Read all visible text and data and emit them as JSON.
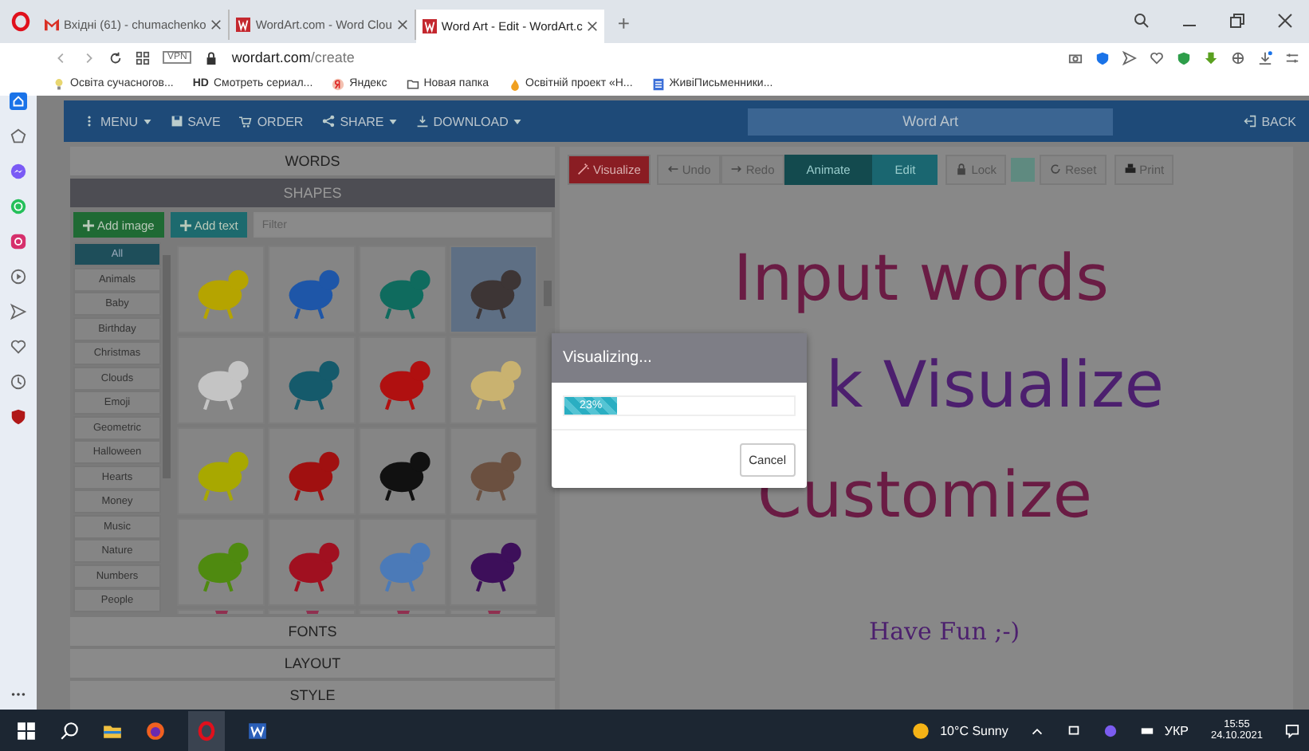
{
  "browser": {
    "tabs": [
      {
        "title": "Вхідні (61) - chumachenko",
        "selected": false,
        "kind": "mail"
      },
      {
        "title": "WordArt.com - Word Clou",
        "selected": false,
        "kind": "wordart"
      },
      {
        "title": "Word Art - Edit - WordArt.c",
        "selected": true,
        "kind": "wordart"
      }
    ],
    "new_tab": "+",
    "vpn": "VPN",
    "url_host": "wordart.com",
    "url_path": "/create",
    "bookmarks": [
      {
        "label": "Освіта сучасногов...",
        "kind": "bulb"
      },
      {
        "label": "Смотреть сериал...",
        "kind": "hd",
        "badge": "HD"
      },
      {
        "label": "Яндекс",
        "kind": "yandex"
      },
      {
        "label": "Новая папка",
        "kind": "folder"
      },
      {
        "label": "Освітній проект «Н...",
        "kind": "flame"
      },
      {
        "label": "ЖивіПисьменники...",
        "kind": "doc"
      }
    ]
  },
  "app": {
    "menu": [
      {
        "label": "MENU",
        "kind": "dots",
        "caret": true
      },
      {
        "label": "SAVE",
        "kind": "save",
        "caret": false
      },
      {
        "label": "ORDER",
        "kind": "cart",
        "caret": false
      },
      {
        "label": "SHARE",
        "kind": "share",
        "caret": true
      },
      {
        "label": "DOWNLOAD",
        "kind": "download",
        "caret": true
      }
    ],
    "title": "Word Art",
    "back": "BACK",
    "sections_top": [
      {
        "label": "WORDS",
        "selected": false
      },
      {
        "label": "SHAPES",
        "selected": true
      }
    ],
    "add_image": "Add image",
    "add_text": "Add text",
    "filter": {
      "placeholder": "Filter"
    },
    "categories": [
      {
        "label": "All",
        "selected": true
      },
      {
        "label": "Animals",
        "selected": false
      },
      {
        "label": "Baby",
        "selected": false
      },
      {
        "label": "Birthday",
        "selected": false
      },
      {
        "label": "Christmas",
        "selected": false
      },
      {
        "label": "Clouds",
        "selected": false
      },
      {
        "label": "Emoji",
        "selected": false
      },
      {
        "label": "Geometric",
        "selected": false
      },
      {
        "label": "Halloween",
        "selected": false
      },
      {
        "label": "Hearts",
        "selected": false
      },
      {
        "label": "Money",
        "selected": false
      },
      {
        "label": "Music",
        "selected": false
      },
      {
        "label": "Nature",
        "selected": false
      },
      {
        "label": "Numbers",
        "selected": false
      },
      {
        "label": "People",
        "selected": false
      }
    ],
    "shapes": [
      {
        "kind": "giraffe",
        "selected": false
      },
      {
        "kind": "bluebird",
        "selected": false
      },
      {
        "kind": "dove",
        "selected": false
      },
      {
        "kind": "hedgehog",
        "selected": true
      },
      {
        "kind": "whale",
        "selected": false
      },
      {
        "kind": "penguin",
        "selected": false
      },
      {
        "kind": "crab",
        "selected": false
      },
      {
        "kind": "chick",
        "selected": false
      },
      {
        "kind": "butterfly",
        "selected": false
      },
      {
        "kind": "rooster",
        "selected": false
      },
      {
        "kind": "eagle",
        "selected": false
      },
      {
        "kind": "cow",
        "selected": false
      },
      {
        "kind": "turtle",
        "selected": false
      },
      {
        "kind": "lizard",
        "selected": false
      },
      {
        "kind": "bluebird2",
        "selected": false
      },
      {
        "kind": "octopus",
        "selected": false
      },
      {
        "kind": "partial",
        "selected": false
      },
      {
        "kind": "partial",
        "selected": false
      },
      {
        "kind": "partial",
        "selected": false
      },
      {
        "kind": "partial",
        "selected": false
      }
    ],
    "sections_bottom": [
      {
        "label": "FONTS",
        "selected": false
      },
      {
        "label": "LAYOUT",
        "selected": false
      },
      {
        "label": "STYLE",
        "selected": false
      }
    ],
    "toolbar": [
      {
        "label": "Visualize",
        "kind": "visualize"
      },
      {
        "label": "Undo",
        "kind": "undo"
      },
      {
        "label": "Redo",
        "kind": "redo"
      },
      {
        "label": "Animate",
        "kind": "mode",
        "selected": true
      },
      {
        "label": "Edit",
        "kind": "mode",
        "selected": false
      },
      {
        "label": "Lock",
        "kind": "lock"
      },
      {
        "kind": "swatch",
        "color": "#5f8a80"
      },
      {
        "label": "Reset",
        "kind": "reset"
      },
      {
        "label": "Print",
        "kind": "print"
      }
    ],
    "canvas_words": [
      {
        "text": "Input words",
        "kind": "big",
        "color": "#6a1c44"
      },
      {
        "text": "k Visualize",
        "kind": "big",
        "color": "#4c1f6e"
      },
      {
        "text": "Customize",
        "kind": "big",
        "color": "#6a1c44"
      },
      {
        "text": "Have Fun ;-)",
        "kind": "small",
        "color": "#4c1f6e"
      }
    ],
    "dialog": {
      "title": "Visualizing...",
      "progress": {
        "level": 0.23,
        "reading": "23%"
      },
      "cancel": "Cancel"
    }
  },
  "taskbar": {
    "weather": "10°C Sunny",
    "language": "УКР",
    "time": "15:55",
    "date": "24.10.2021"
  }
}
